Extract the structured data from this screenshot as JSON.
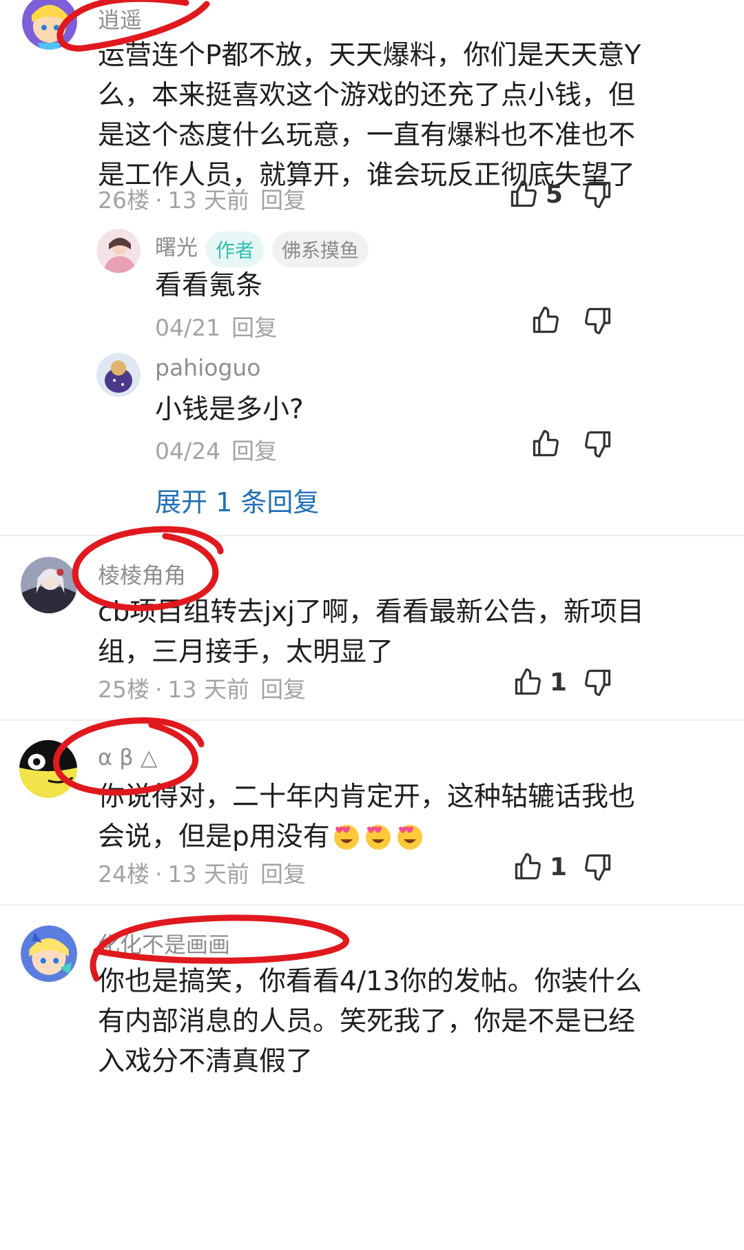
{
  "comments": [
    {
      "username": "逍遥",
      "lines": [
        "运营连个P都不放，天天爆料，你们是天天意Y",
        "么，本来挺喜欢这个游戏的还充了点小钱，但",
        "是这个态度什么玩意，一直有爆料也不准也不",
        "是工作人员，就算开，谁会玩反正彻底失望了"
      ],
      "floor": "26楼",
      "time": "13 天前",
      "reply": "回复",
      "likes": "5",
      "replies": [
        {
          "username": "曙光",
          "badge_author": "作者",
          "badge_tag": "佛系摸鱼",
          "text": "看看氪条",
          "date": "04/21",
          "reply": "回复"
        },
        {
          "username": "pahioguo",
          "text": "小钱是多小?",
          "date": "04/24",
          "reply": "回复"
        }
      ],
      "expand": "展开 1 条回复"
    },
    {
      "username": "棱棱角角",
      "lines": [
        "cb项目组转去jxj了啊，看看最新公告，新项目",
        "组，三月接手，太明显了"
      ],
      "floor": "25楼",
      "time": "13 天前",
      "reply": "回复",
      "likes": "1"
    },
    {
      "username": "α β △",
      "lines": [
        "你说得对，二十年内肯定开，这种轱辘话我也",
        "会说，但是p用没有"
      ],
      "floor": "24楼",
      "time": "13 天前",
      "reply": "回复",
      "likes": "1"
    },
    {
      "username": "化化不是画画",
      "lines": [
        "你也是搞笑，你看看4/13你的发帖。你装什么",
        "有内部消息的人员。笑死我了，你是不是已经",
        "入戏分不清真假了"
      ]
    }
  ],
  "sep": "·",
  "colors": {
    "scribble": "#e0191e",
    "link": "#1f6fb5",
    "author_badge": "#2fbfb0"
  }
}
